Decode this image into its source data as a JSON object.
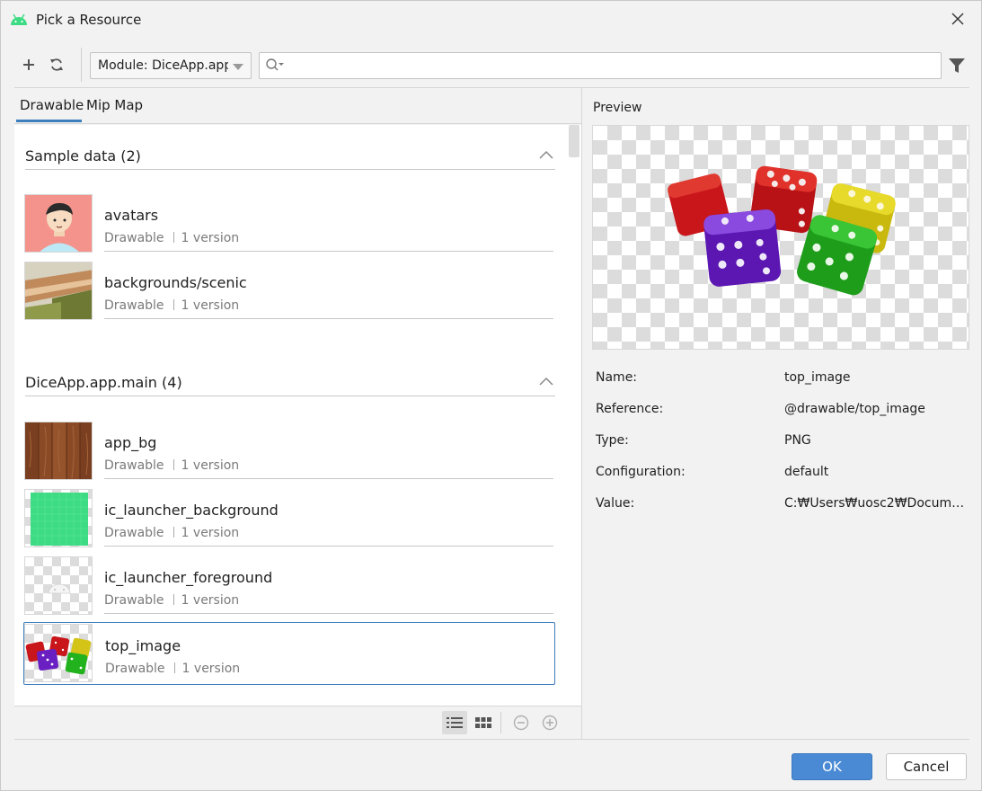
{
  "window": {
    "title": "Pick a Resource"
  },
  "toolbar": {
    "module_label": "Module: DiceApp.app",
    "search_placeholder": "",
    "search_value": ""
  },
  "tabs": [
    {
      "label": "Drawable",
      "active": true
    },
    {
      "label": "Mip Map",
      "active": false
    }
  ],
  "sections": [
    {
      "title": "Sample data (2)",
      "items": [
        {
          "name": "avatars",
          "type": "Drawable",
          "versions": "1 version",
          "icon": "avatar-thumbnail"
        },
        {
          "name": "backgrounds/scenic",
          "type": "Drawable",
          "versions": "1 version",
          "icon": "scenic-thumbnail"
        }
      ]
    },
    {
      "title": "DiceApp.app.main (4)",
      "items": [
        {
          "name": "app_bg",
          "type": "Drawable",
          "versions": "1 version",
          "icon": "wood-thumbnail"
        },
        {
          "name": "ic_launcher_background",
          "type": "Drawable",
          "versions": "1 version",
          "icon": "green-grid-thumbnail"
        },
        {
          "name": "ic_launcher_foreground",
          "type": "Drawable",
          "versions": "1 version",
          "icon": "android-thumbnail"
        },
        {
          "name": "top_image",
          "type": "Drawable",
          "versions": "1 version",
          "icon": "dice-thumbnail",
          "selected": true
        }
      ]
    }
  ],
  "preview": {
    "label": "Preview",
    "properties": [
      {
        "label": "Name:",
        "value": "top_image"
      },
      {
        "label": "Reference:",
        "value": "@drawable/top_image"
      },
      {
        "label": "Type:",
        "value": "PNG"
      },
      {
        "label": "Configuration:",
        "value": "default"
      },
      {
        "label": "Value:",
        "value": "C:₩Users₩uosc2₩Document..."
      }
    ]
  },
  "buttons": {
    "ok": "OK",
    "cancel": "Cancel"
  },
  "colors": {
    "accent": "#3d7ebd",
    "ok_button": "#4a8ad4",
    "android_green": "#3ddc84"
  }
}
